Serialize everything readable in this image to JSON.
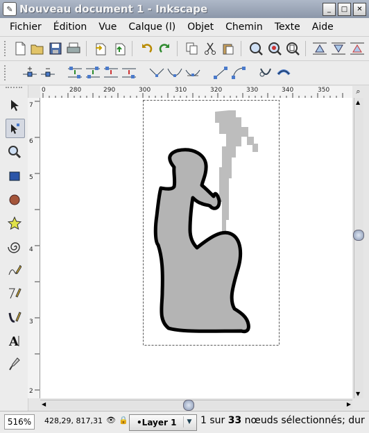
{
  "window": {
    "title": "Nouveau document 1 - Inkscape"
  },
  "menu": [
    "Fichier",
    "Édition",
    "Vue",
    "Calque (l)",
    "Objet",
    "Chemin",
    "Texte",
    "Aide"
  ],
  "toolbar_icons": [
    "new-icon",
    "open-icon",
    "save-icon",
    "print-icon",
    "import-icon",
    "export-icon",
    "undo-icon",
    "redo-icon",
    "copy-icon",
    "cut-icon",
    "paste-icon",
    "zoom-selection-icon",
    "zoom-drawing-icon",
    "zoom-page-icon",
    "align-icon-1",
    "align-icon-2",
    "align-icon-3"
  ],
  "node_toolbar_icons": [
    "insert-node-icon",
    "delete-node-icon",
    "join-nodes-icon",
    "break-path-icon",
    "join-segment-icon",
    "delete-segment-icon",
    "cusp-node-icon",
    "smooth-node-icon",
    "symmetric-node-icon",
    "line-segment-icon",
    "curve-segment-icon",
    "object-to-path-icon",
    "stroke-to-path-icon"
  ],
  "tools": [
    "selector-tool-icon",
    "node-tool-icon",
    "zoom-tool-icon",
    "rectangle-tool-icon",
    "ellipse-tool-icon",
    "star-tool-icon",
    "spiral-tool-icon",
    "pencil-tool-icon",
    "pen-tool-icon",
    "calligraphy-tool-icon",
    "text-tool-icon",
    "dropper-tool-icon"
  ],
  "ruler": {
    "h_labels": [
      "0",
      "280",
      "290",
      "300",
      "310",
      "320",
      "330",
      "340",
      "350"
    ],
    "v_labels": [
      "7",
      "6",
      "5",
      "4",
      "3",
      "2"
    ]
  },
  "status": {
    "zoom": "516%",
    "coords": "428,29, 817,31",
    "layer": "•Layer 1",
    "message_prefix": "1 sur ",
    "message_count": "33",
    "message_suffix": " nœuds sélectionnés; dur"
  },
  "colors": {
    "shape_fill": "#b4b4b4",
    "outline": "#000000",
    "ghost": "#bdbdbd"
  }
}
